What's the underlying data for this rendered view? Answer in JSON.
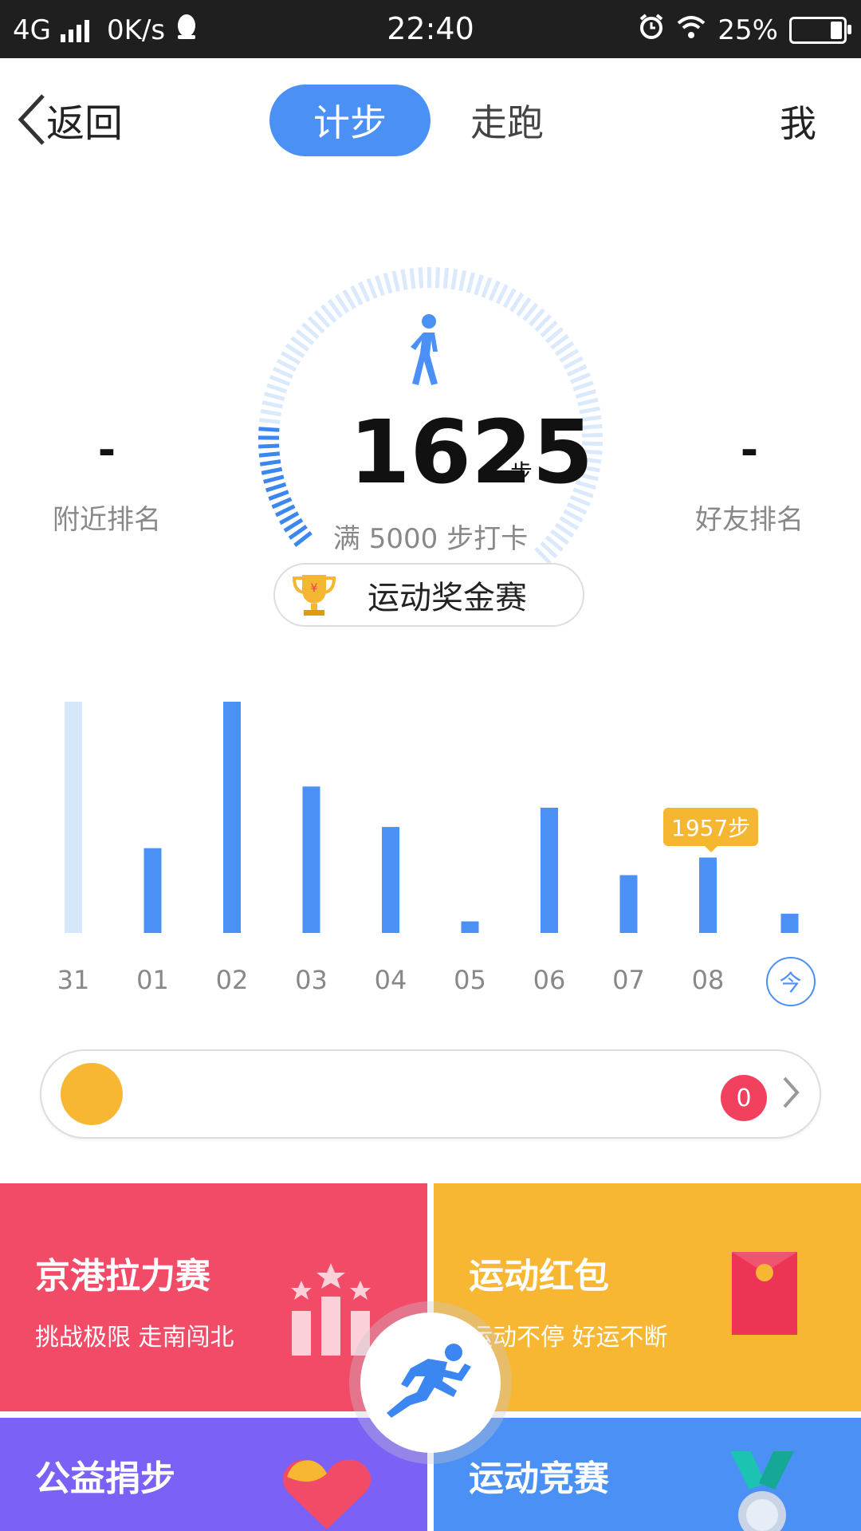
{
  "status_bar": {
    "network": "4G",
    "speed": "0K/s",
    "time": "22:40",
    "battery": "25%",
    "battery_level": 0.25
  },
  "nav": {
    "back_label": "返回",
    "tabs": [
      {
        "label": "计步",
        "active": true
      },
      {
        "label": "走跑",
        "active": false
      }
    ],
    "me_label": "我"
  },
  "pedometer": {
    "steps": "1625",
    "unit": "步",
    "goal_text": "满 5000 步打卡",
    "progress_fraction": 0.325,
    "nearby_rank": {
      "value": "-",
      "label": "附近排名"
    },
    "friend_rank": {
      "value": "-",
      "label": "好友排名"
    },
    "prize_label": "运动奖金赛"
  },
  "chart_data": {
    "type": "bar",
    "categories": [
      "31",
      "01",
      "02",
      "03",
      "04",
      "05",
      "06",
      "07",
      "08",
      "今"
    ],
    "values": [
      6000,
      2200,
      6000,
      3800,
      2750,
      300,
      3250,
      1500,
      1957,
      500
    ],
    "selected_label": "1957步",
    "selected_index": 8,
    "ylim": [
      0,
      6000
    ],
    "colors": {
      "bar": "#4a90f5",
      "bar_faded": "#d6e7fc",
      "highlight": "#f5b731"
    }
  },
  "progress_pill": {
    "badge_count": "0"
  },
  "tiles": [
    {
      "title": "京港拉力赛",
      "subtitle": "挑战极限 走南闯北",
      "color": "#f14b67"
    },
    {
      "title": "运动红包",
      "subtitle": "运动不停 好运不断",
      "color": "#f7b733"
    },
    {
      "title": "公益捐步",
      "subtitle": "",
      "color": "#7b61f6"
    },
    {
      "title": "运动竞赛",
      "subtitle": "",
      "color": "#4a90f5"
    }
  ],
  "icons": {
    "back": "chevron-left-icon",
    "walker": "walking-person-icon",
    "trophy": "trophy-icon",
    "runner": "running-person-icon",
    "red_packet": "red-envelope-icon",
    "podium": "podium-stars-icon",
    "heart": "heart-icon",
    "medal": "medal-icon"
  }
}
